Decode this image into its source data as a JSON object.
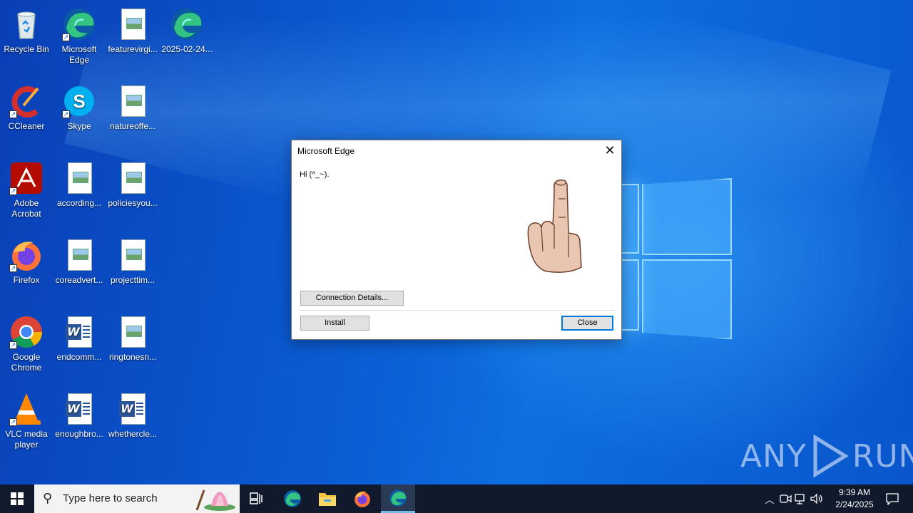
{
  "desktop": {
    "icons": [
      {
        "label": "Recycle Bin",
        "icon": "recycle-bin-icon"
      },
      {
        "label": "Microsoft Edge",
        "icon": "edge-icon"
      },
      {
        "label": "featurevirgi...",
        "icon": "image-file-icon"
      },
      {
        "label": "2025-02-24...",
        "icon": "edge-icon"
      },
      {
        "label": "CCleaner",
        "icon": "ccleaner-icon"
      },
      {
        "label": "Skype",
        "icon": "skype-icon"
      },
      {
        "label": "natureoffe...",
        "icon": "image-file-icon"
      },
      {
        "label": "Adobe Acrobat",
        "icon": "acrobat-icon"
      },
      {
        "label": "according...",
        "icon": "image-file-icon"
      },
      {
        "label": "policiesyou...",
        "icon": "image-file-icon"
      },
      {
        "label": "Firefox",
        "icon": "firefox-icon"
      },
      {
        "label": "coreadvert...",
        "icon": "image-file-icon"
      },
      {
        "label": "projecttim...",
        "icon": "image-file-icon"
      },
      {
        "label": "Google Chrome",
        "icon": "chrome-icon"
      },
      {
        "label": "endcomm...",
        "icon": "word-document-icon"
      },
      {
        "label": "ringtonesn...",
        "icon": "image-file-icon"
      },
      {
        "label": "VLC media player",
        "icon": "vlc-icon"
      },
      {
        "label": "enoughbro...",
        "icon": "word-document-icon"
      },
      {
        "label": "whethercle...",
        "icon": "word-document-icon"
      }
    ]
  },
  "dialog": {
    "title": "Microsoft Edge",
    "close_glyph": "✕",
    "message": "Hi (^_~).",
    "image": "middle-finger-hand-icon",
    "buttons": {
      "details": "Connection Details...",
      "install": "Install",
      "close": "Close"
    }
  },
  "watermark": {
    "left": "ANY",
    "right": "RUN"
  },
  "taskbar": {
    "search_placeholder": "Type here to search",
    "pinned": [
      "task-view-icon",
      "edge-icon",
      "file-explorer-icon",
      "firefox-icon",
      "edge-icon"
    ],
    "clock": {
      "time": "9:39 AM",
      "date": "2/24/2025"
    }
  },
  "colors": {
    "desktop_blue": "#0b5fd6",
    "taskbar": "#101a2c",
    "focus_blue": "#0078d7"
  }
}
